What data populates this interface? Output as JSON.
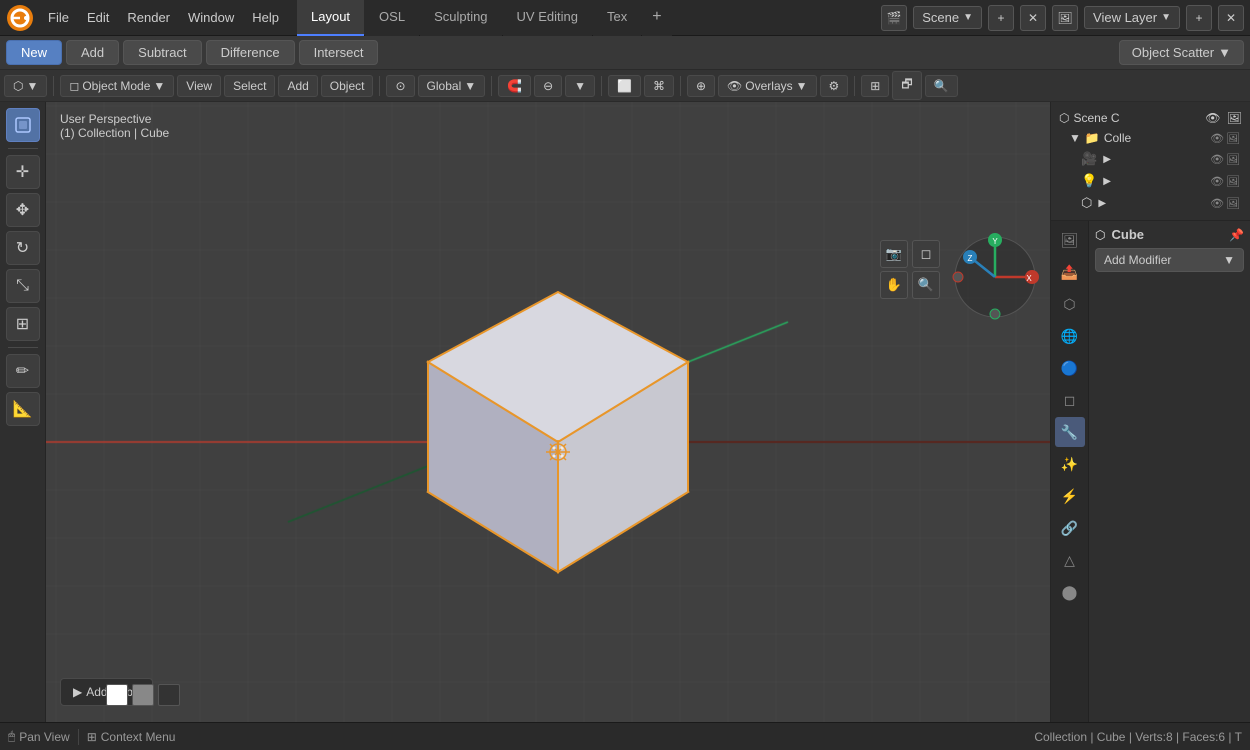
{
  "app": {
    "title": "Blender"
  },
  "top_menu": {
    "items": [
      "File",
      "Edit",
      "Render",
      "Window",
      "Help"
    ],
    "workspace_tabs": [
      {
        "label": "Layout",
        "active": true
      },
      {
        "label": "OSL",
        "active": false
      },
      {
        "label": "Sculpting",
        "active": false
      },
      {
        "label": "UV Editing",
        "active": false
      },
      {
        "label": "Tex",
        "active": false
      }
    ],
    "scene_label": "Scene",
    "view_layer_label": "View Layer"
  },
  "boolean_toolbar": {
    "new_label": "New",
    "add_label": "Add",
    "subtract_label": "Subtract",
    "difference_label": "Difference",
    "intersect_label": "Intersect",
    "object_scatter_label": "Object Scatter"
  },
  "viewport_toolbar": {
    "mode_label": "Object Mode",
    "view_label": "View",
    "select_label": "Select",
    "add_label": "Add",
    "object_label": "Object",
    "transform_label": "Global",
    "overlays_label": "Overlays"
  },
  "viewport": {
    "perspective_label": "User Perspective",
    "collection_label": "(1) Collection | Cube"
  },
  "left_toolbar": {
    "tools": [
      "cursor",
      "move",
      "rotate",
      "scale",
      "transform",
      "annotate",
      "measure"
    ]
  },
  "scene_collection": {
    "title": "Scene C",
    "items": [
      {
        "label": "Colle",
        "indent": 1,
        "type": "collection"
      },
      {
        "label": "",
        "indent": 2,
        "type": "camera"
      },
      {
        "label": "",
        "indent": 2,
        "type": "light"
      },
      {
        "label": "",
        "indent": 2,
        "type": "object"
      },
      {
        "label": "",
        "indent": 2,
        "type": "object2"
      }
    ]
  },
  "properties": {
    "active_object": "Cube",
    "add_modifier_label": "Add Modifier",
    "icons": [
      "scene",
      "layer",
      "world",
      "object",
      "modifier",
      "particles",
      "physics",
      "constraints",
      "data",
      "material",
      "render",
      "output"
    ]
  },
  "status_bar": {
    "pan_view_label": "Pan View",
    "context_menu_label": "Context Menu",
    "info_label": "Collection | Cube | Verts:8 | Faces:6 | T"
  },
  "notification": {
    "add_cube_label": "Add Cube"
  },
  "colors": {
    "accent_blue": "#5272a5",
    "active_orange": "#e8962a",
    "grid_line": "#4a4a4a",
    "bg_dark": "#2f2f2f",
    "cube_face_light": "#c8c8d0",
    "cube_face_dark": "#9090a0",
    "cube_outline": "#e8962a"
  }
}
